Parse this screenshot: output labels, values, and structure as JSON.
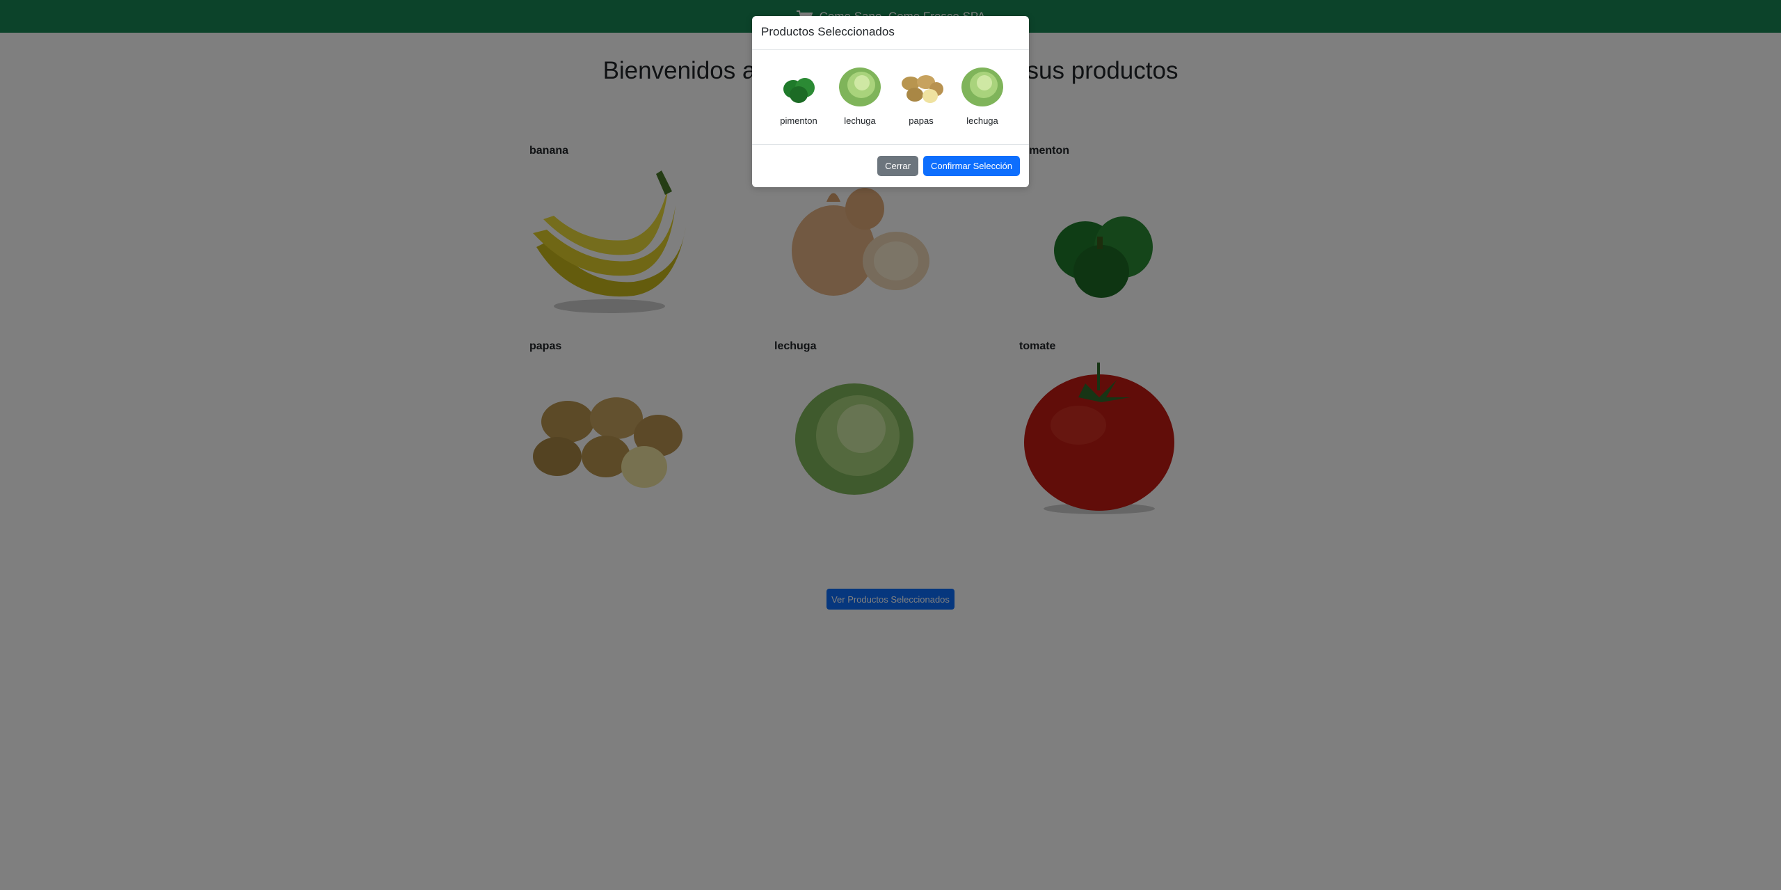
{
  "navbar": {
    "brand": "Come Sano, Come Fresco SPA",
    "icon": "cart-icon"
  },
  "page": {
    "title": "Bienvenidos a Come Sano, seleccione sus productos"
  },
  "products": [
    {
      "name": "banana"
    },
    {
      "name": "cebolla"
    },
    {
      "name": "pimenton"
    },
    {
      "name": "papas"
    },
    {
      "name": "lechuga"
    },
    {
      "name": "tomate"
    }
  ],
  "view_button": {
    "label": "Ver Productos Seleccionados"
  },
  "modal": {
    "title": "Productos Seleccionados",
    "items": [
      {
        "name": "pimenton"
      },
      {
        "name": "lechuga"
      },
      {
        "name": "papas"
      },
      {
        "name": "lechuga"
      }
    ],
    "close_label": "Cerrar",
    "confirm_label": "Confirmar Selección"
  },
  "colors": {
    "navbar": "#198754",
    "primary": "#0d6efd",
    "secondary": "#6c757d"
  }
}
